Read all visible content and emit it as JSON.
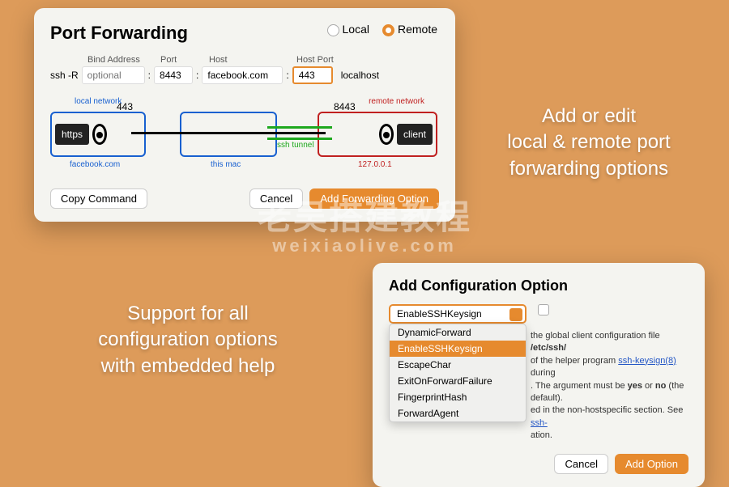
{
  "port_forwarding": {
    "title": "Port Forwarding",
    "radio_local": "Local",
    "radio_remote": "Remote",
    "radio_selected": "Remote",
    "labels": {
      "bind": "Bind Address",
      "port": "Port",
      "host": "Host",
      "hostport": "Host Port"
    },
    "cmd_prefix": "ssh -R",
    "fields": {
      "bind_placeholder": "optional",
      "bind_value": "",
      "port_value": "8443",
      "host_value": "facebook.com",
      "hostport_value": "443"
    },
    "cmd_suffix": "localhost",
    "diagram": {
      "local_net": "local network",
      "remote_net": "remote network",
      "local_port": "443",
      "remote_port": "8443",
      "local_chip": "https",
      "remote_chip": "client",
      "local_host": "facebook.com",
      "middle_host": "this mac",
      "remote_host": "127.0.0.1",
      "tunnel_label": "ssh tunnel"
    },
    "buttons": {
      "copy": "Copy Command",
      "cancel": "Cancel",
      "add": "Add Forwarding Option"
    }
  },
  "headline1": "Add or edit\nlocal & remote port\nforwarding options",
  "headline2": "Support for all\nconfiguration options\nwith embedded help",
  "config_option": {
    "title": "Add Configuration Option",
    "dropdown_value": "EnableSSHKeysign",
    "dropdown_items": [
      "DynamicForward",
      "EnableSSHKeysign",
      "EscapeChar",
      "ExitOnForwardFailure",
      "FingerprintHash",
      "ForwardAgent"
    ],
    "checkbox_checked": false,
    "help_html_parts": {
      "p1a": "the global client configuration file ",
      "p1b": "/etc/ssh/",
      "p2a": " of the helper program ",
      "p2b": "ssh-keysign(8)",
      "p2c": " during ",
      "p3a": ". The argument must be ",
      "p3b": "yes",
      "p3c": " or ",
      "p3d": "no",
      "p3e": " (the default).",
      "p4a": "ed in the non-hostspecific section. See ",
      "p4b": "ssh-",
      "p5": "ation."
    },
    "buttons": {
      "cancel": "Cancel",
      "add": "Add Option"
    }
  },
  "watermark": {
    "line1": "老吴搭建教程",
    "line2": "weixiaolive.com"
  }
}
